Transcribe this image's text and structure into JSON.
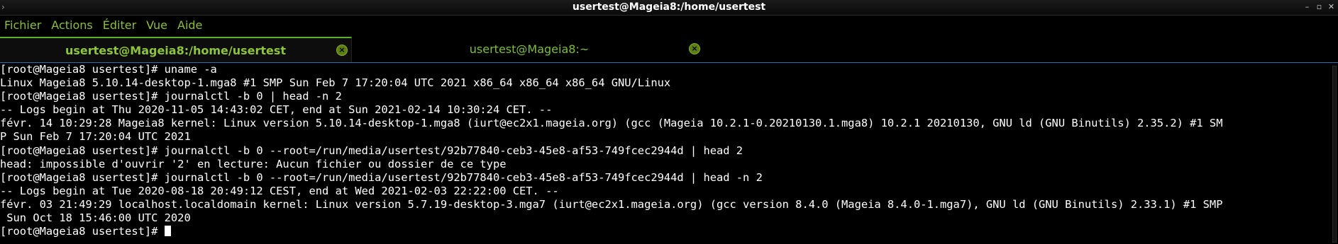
{
  "window": {
    "title": "usertest@Mageia8:/home/usertest",
    "corner_glyph": "›",
    "controls": {
      "minimize": "–",
      "maximize": "▫",
      "close": "✕"
    }
  },
  "menubar": {
    "items": [
      {
        "label": "Fichier"
      },
      {
        "label": "Actions"
      },
      {
        "label": "Éditer"
      },
      {
        "label": "Vue"
      },
      {
        "label": "Aide"
      }
    ]
  },
  "tabs": [
    {
      "label": "usertest@Mageia8:/home/usertest",
      "active": true,
      "close_glyph": "×"
    },
    {
      "label": "usertest@Mageia8:~",
      "active": false,
      "close_glyph": "×"
    }
  ],
  "terminal": {
    "lines": [
      "[root@Mageia8 usertest]# uname -a",
      "Linux Mageia8 5.10.14-desktop-1.mga8 #1 SMP Sun Feb 7 17:20:04 UTC 2021 x86_64 x86_64 x86_64 GNU/Linux",
      "[root@Mageia8 usertest]# journalctl -b 0 | head -n 2",
      "-- Logs begin at Thu 2020-11-05 14:43:02 CET, end at Sun 2021-02-14 10:30:24 CET. --",
      "févr. 14 10:29:28 Mageia8 kernel: Linux version 5.10.14-desktop-1.mga8 (iurt@ec2x1.mageia.org) (gcc (Mageia 10.2.1-0.20210130.1.mga8) 10.2.1 20210130, GNU ld (GNU Binutils) 2.35.2) #1 SM",
      "P Sun Feb 7 17:20:04 UTC 2021",
      "[root@Mageia8 usertest]# journalctl -b 0 --root=/run/media/usertest/92b77840-ceb3-45e8-af53-749fcec2944d | head 2",
      "head: impossible d'ouvrir '2' en lecture: Aucun fichier ou dossier de ce type",
      "[root@Mageia8 usertest]# journalctl -b 0 --root=/run/media/usertest/92b77840-ceb3-45e8-af53-749fcec2944d | head -n 2",
      "-- Logs begin at Tue 2020-08-18 20:49:12 CEST, end at Wed 2021-02-03 22:22:00 CET. --",
      "févr. 03 21:49:29 localhost.localdomain kernel: Linux version 5.7.19-desktop-3.mga7 (iurt@ec2x1.mageia.org) (gcc version 8.4.0 (Mageia 8.4.0-1.mga7), GNU ld (GNU Binutils) 2.33.1) #1 SMP",
      " Sun Oct 18 15:46:00 UTC 2020"
    ],
    "prompt": "[root@Mageia8 usertest]# "
  },
  "colors": {
    "menu_text": "#8dbd3e",
    "tab_accent": "#5ab02a",
    "terminal_bg": "#000000",
    "terminal_fg": "#ffffff",
    "focus_border": "#2a6fb0"
  }
}
